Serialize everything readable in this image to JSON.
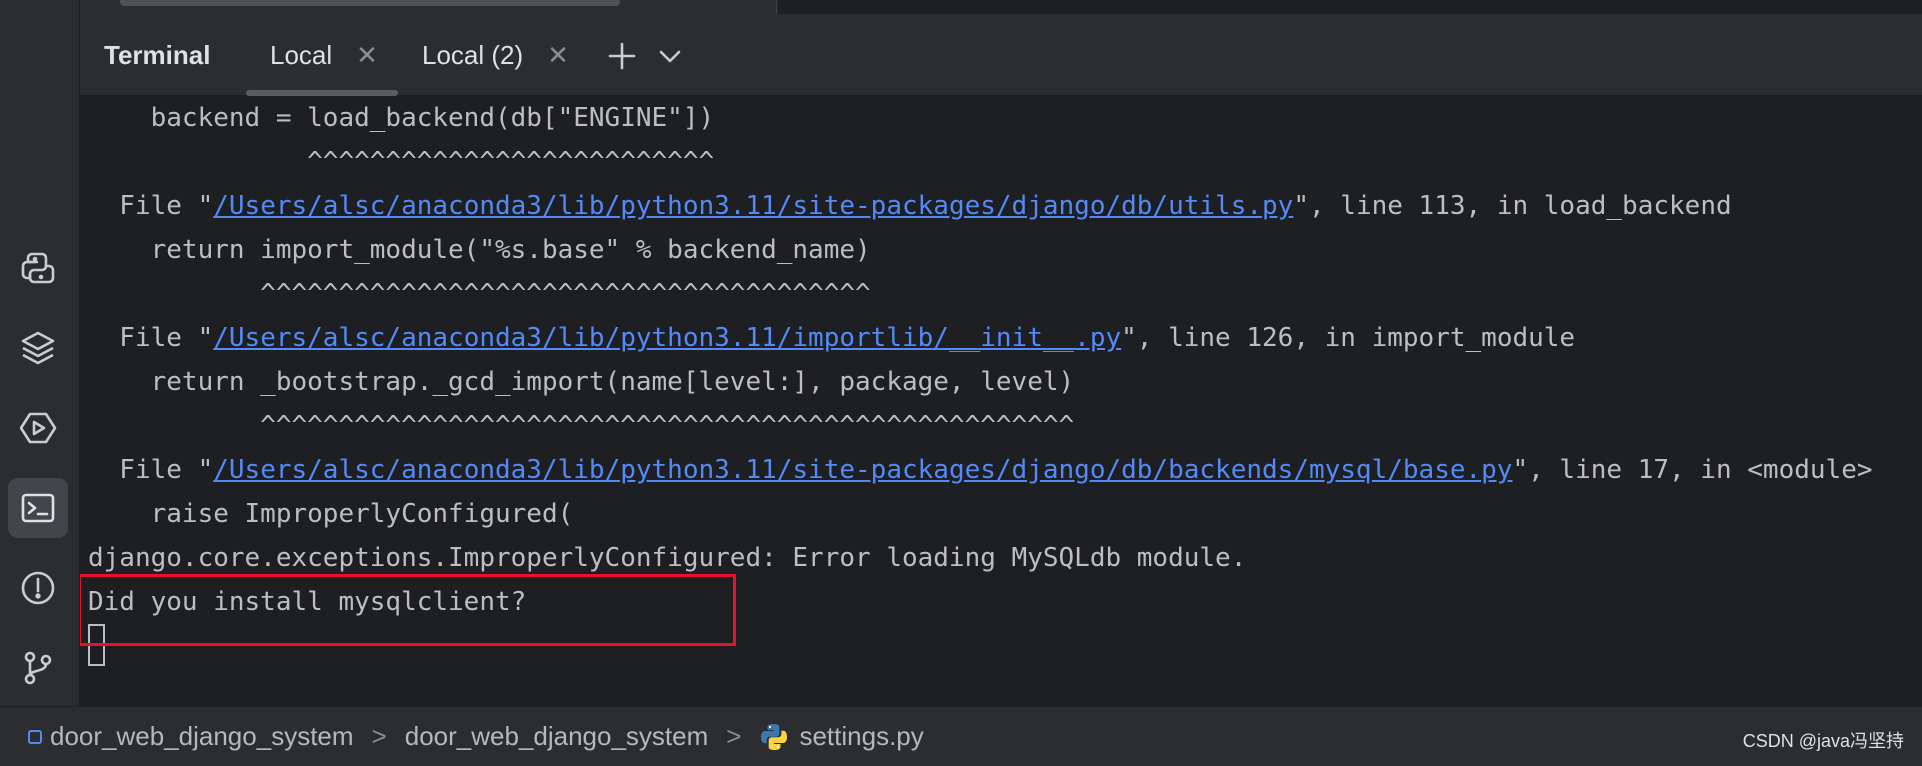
{
  "tool_window": {
    "title": "Terminal",
    "tabs": [
      {
        "label": "Local",
        "active": true
      },
      {
        "label": "Local (2)",
        "active": false
      }
    ],
    "new_tab_icon": "plus-icon",
    "tab_menu_icon": "chevron-down-icon"
  },
  "activity_bar": {
    "icons": [
      "python-console-icon",
      "layers-icon",
      "services-icon",
      "terminal-icon",
      "problems-icon",
      "git-icon"
    ],
    "active": "terminal-icon"
  },
  "terminal": {
    "lines": [
      {
        "text": "    backend = load_backend(db[\"ENGINE\"])"
      },
      {
        "text": "              ^^^^^^^^^^^^^^^^^^^^^^^^^^"
      },
      {
        "prefix": "  File \"",
        "link": "/Users/alsc/anaconda3/lib/python3.11/site-packages/django/db/utils.py",
        "suffix": "\", line 113, in load_backend"
      },
      {
        "text": "    return import_module(\"%s.base\" % backend_name)"
      },
      {
        "text": "           ^^^^^^^^^^^^^^^^^^^^^^^^^^^^^^^^^^^^^^^"
      },
      {
        "prefix": "  File \"",
        "link": "/Users/alsc/anaconda3/lib/python3.11/importlib/__init__.py",
        "suffix": "\", line 126, in import_module"
      },
      {
        "text": "    return _bootstrap._gcd_import(name[level:], package, level)"
      },
      {
        "text": "           ^^^^^^^^^^^^^^^^^^^^^^^^^^^^^^^^^^^^^^^^^^^^^^^^^^^^"
      },
      {
        "prefix": "  File \"",
        "link": "/Users/alsc/anaconda3/lib/python3.11/site-packages/django/db/backends/mysql/base.py",
        "suffix": "\", line 17, in <module>"
      },
      {
        "text": "    raise ImproperlyConfigured("
      },
      {
        "text": "django.core.exceptions.ImproperlyConfigured: Error loading MySQLdb module."
      },
      {
        "text": "Did you install mysqlclient?"
      }
    ]
  },
  "statusbar": {
    "breadcrumbs": [
      "door_web_django_system",
      "door_web_django_system",
      "settings.py"
    ],
    "separator": ">",
    "watermark": "CSDN @java冯坚持"
  },
  "colors": {
    "link": "#548af7",
    "highlight_border": "#e8112d",
    "background": "#1e1f22",
    "panel": "#2b2d30"
  }
}
